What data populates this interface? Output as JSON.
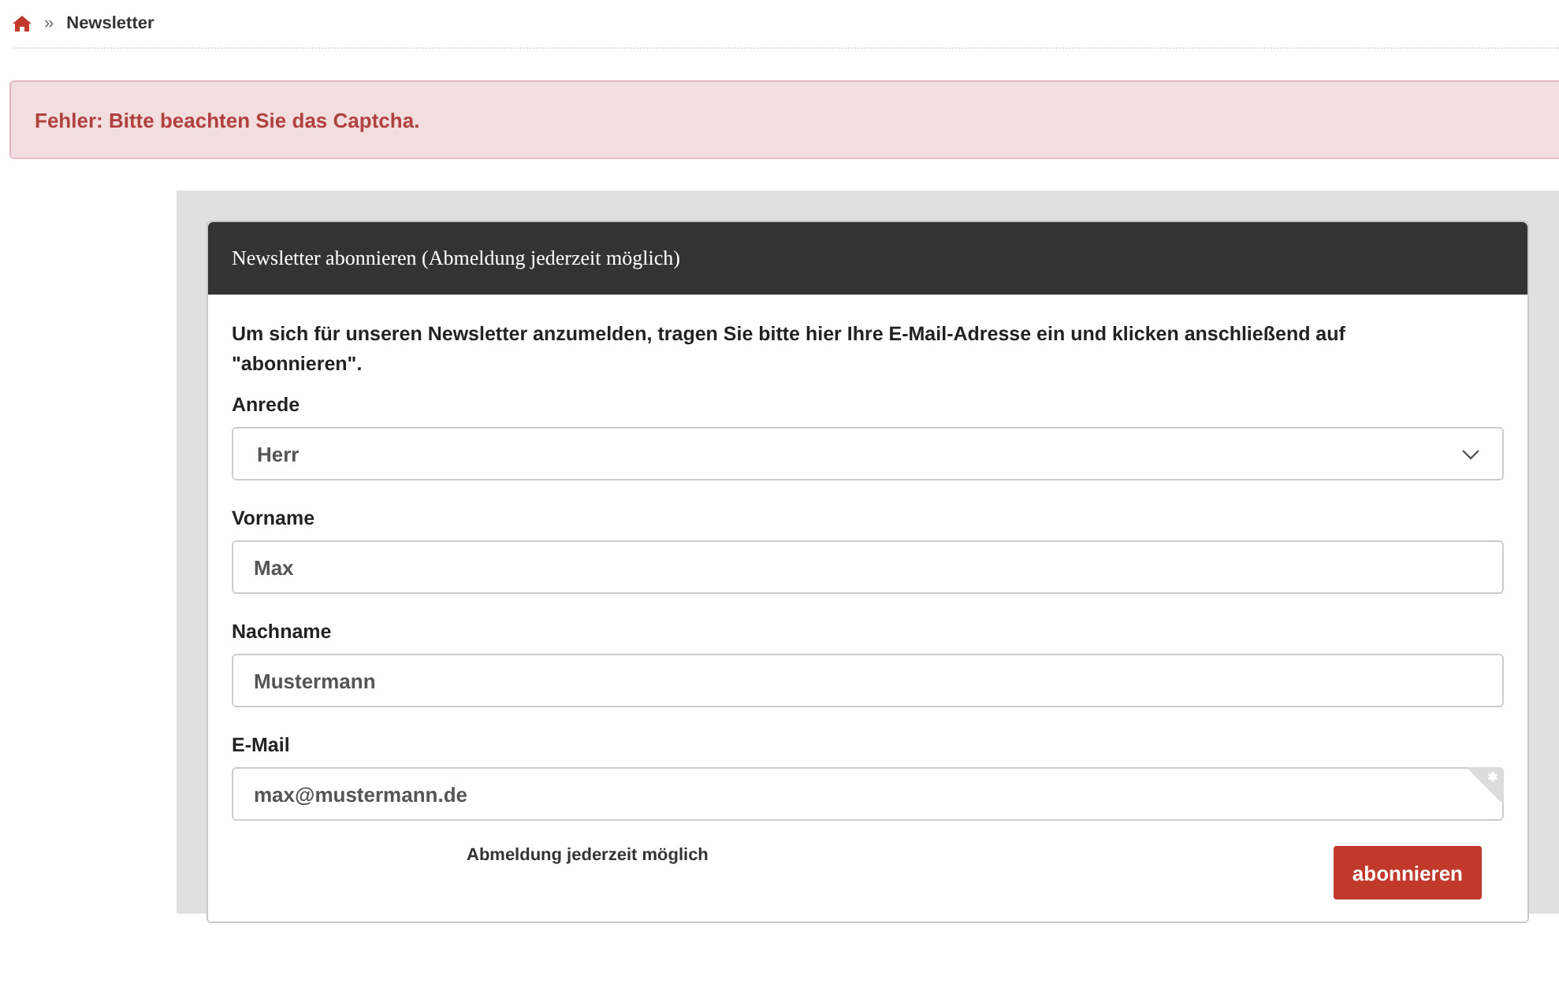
{
  "breadcrumb": {
    "items": [
      {
        "kind": "home"
      },
      {
        "kind": "text",
        "label": "Newsletter"
      }
    ],
    "separator": "»"
  },
  "alert": {
    "text": "Fehler: Bitte beachten Sie das Captcha."
  },
  "form": {
    "title": "Newsletter abonnieren (Abmeldung jederzeit möglich)",
    "intro": "Um sich für unseren Newsletter anzumelden, tragen Sie bitte hier Ihre E-Mail-Adresse ein und klicken anschließend auf \"abonnieren\".",
    "fields": [
      {
        "kind": "select",
        "label": "Anrede",
        "value": "Herr",
        "required": false
      },
      {
        "kind": "text",
        "label": "Vorname",
        "value": "Max",
        "required": false
      },
      {
        "kind": "text",
        "label": "Nachname",
        "value": "Mustermann",
        "required": false
      },
      {
        "kind": "text",
        "label": "E-Mail",
        "value": "max@mustermann.de",
        "required": true
      }
    ],
    "note": "Abmeldung jederzeit möglich",
    "submit": "abonnieren"
  }
}
